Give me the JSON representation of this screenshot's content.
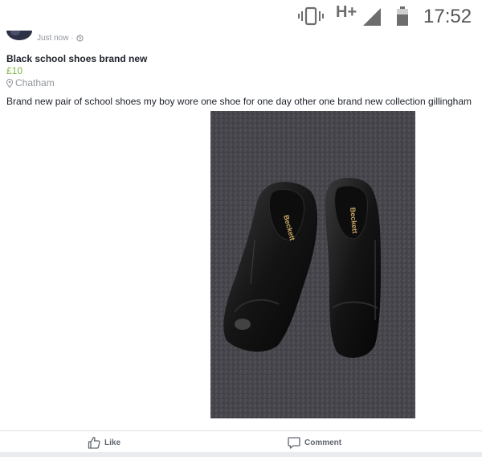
{
  "status_bar": {
    "network": "H+",
    "time": "17:52",
    "icons": [
      "vibrate-icon",
      "signal-icon",
      "battery-icon"
    ]
  },
  "post": {
    "timestamp": "Just now ·",
    "title": "Black school shoes brand new",
    "price": "£10",
    "location": "Chatham",
    "description": "Brand new pair of school shoes my boy wore one shoe for one day other one brand new collection gillingham",
    "photo": {
      "shoe_brand_left": "Beckett",
      "shoe_brand_right": "Beckett"
    }
  },
  "actions": {
    "like_label": "Like",
    "comment_label": "Comment"
  },
  "colors": {
    "price": "#7cb342",
    "muted": "#90949c",
    "text": "#1d2129"
  }
}
